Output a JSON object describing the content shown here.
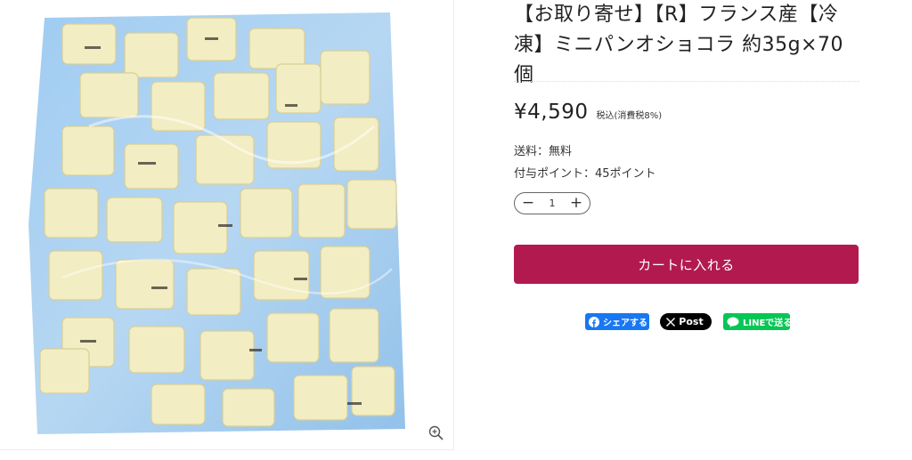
{
  "product": {
    "title_line1": "【お取り寄せ】【R】フランス産【冷",
    "title_line2": "凍】ミニパンオショコラ 約35g×70個",
    "image_alt": "ミニパンオショコラ"
  },
  "pricing": {
    "price": "¥4,590",
    "tax_note": "税込(消費税8%)"
  },
  "shipping_text": "送料：無料",
  "points_text": "付与ポイント：45ポイント",
  "quantity": {
    "value": "1",
    "minus": "−",
    "plus": "+"
  },
  "cart": {
    "label": "カートに入れる",
    "color": "#b21a4f"
  },
  "share": {
    "facebook_label": "シェアする",
    "x_label": "Post",
    "line_label": "LINEで送る"
  },
  "icons": [
    "zoom-in-icon",
    "facebook-icon",
    "x-logo-icon",
    "line-icon"
  ]
}
